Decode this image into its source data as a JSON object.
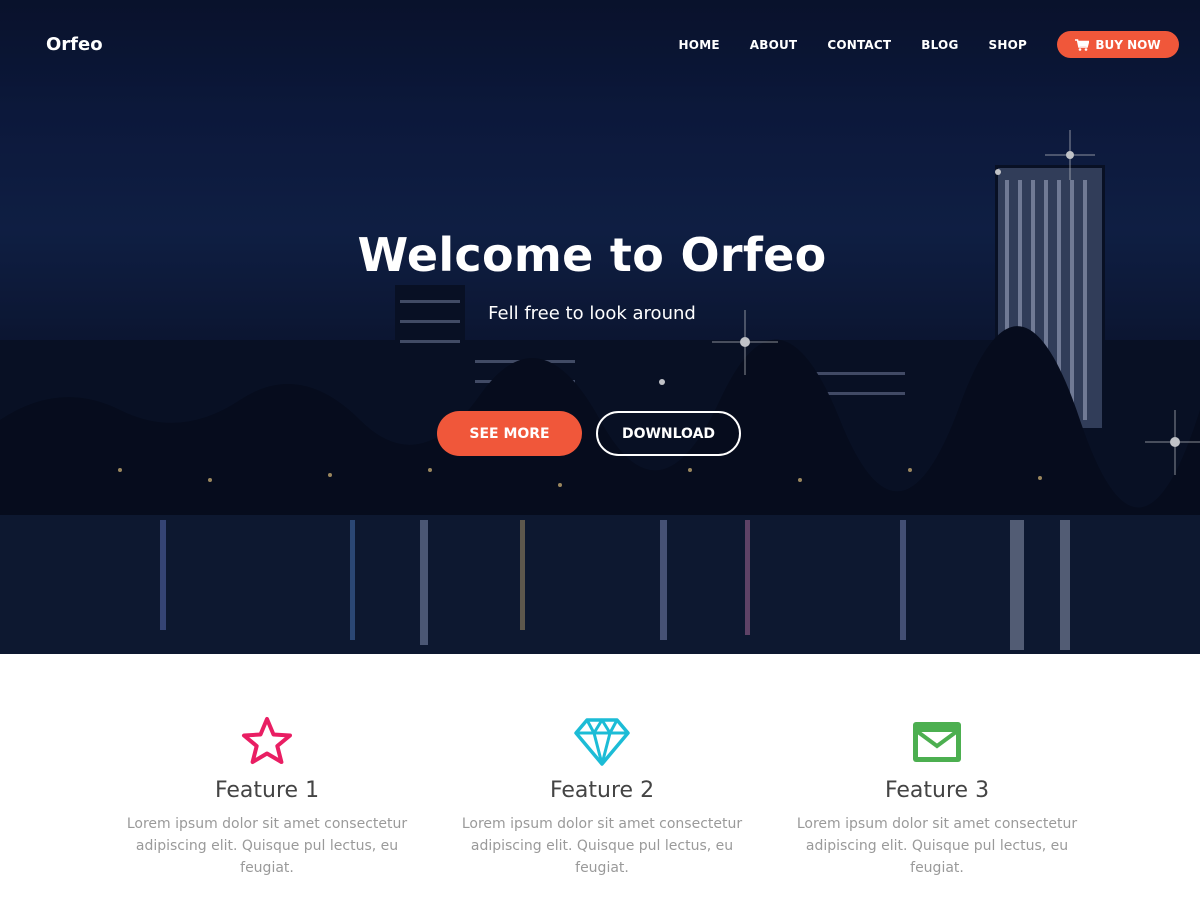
{
  "nav": {
    "brand": "Orfeo",
    "items": [
      {
        "label": "HOME"
      },
      {
        "label": "ABOUT"
      },
      {
        "label": "CONTACT"
      },
      {
        "label": "BLOG"
      },
      {
        "label": "SHOP"
      }
    ],
    "buy_label": "BUY NOW"
  },
  "hero": {
    "title": "Welcome to Orfeo",
    "subtitle": "Fell free to look around",
    "primary_button": "SEE MORE",
    "secondary_button": "DOWNLOAD"
  },
  "features": [
    {
      "title": "Feature 1",
      "text": "Lorem ipsum dolor sit amet consectetur adipiscing elit. Quisque pul lectus, eu feugiat.",
      "icon": "star-icon",
      "color": "#e91e63"
    },
    {
      "title": "Feature 2",
      "text": "Lorem ipsum dolor sit amet consectetur adipiscing elit. Quisque pul lectus, eu feugiat.",
      "icon": "diamond-icon",
      "color": "#1cbcd6"
    },
    {
      "title": "Feature 3",
      "text": "Lorem ipsum dolor sit amet consectetur adipiscing elit. Quisque pul lectus, eu feugiat.",
      "icon": "envelope-icon",
      "color": "#4caf50"
    }
  ],
  "colors": {
    "accent": "#f0573a",
    "hero_bg": "#0f1d45"
  }
}
